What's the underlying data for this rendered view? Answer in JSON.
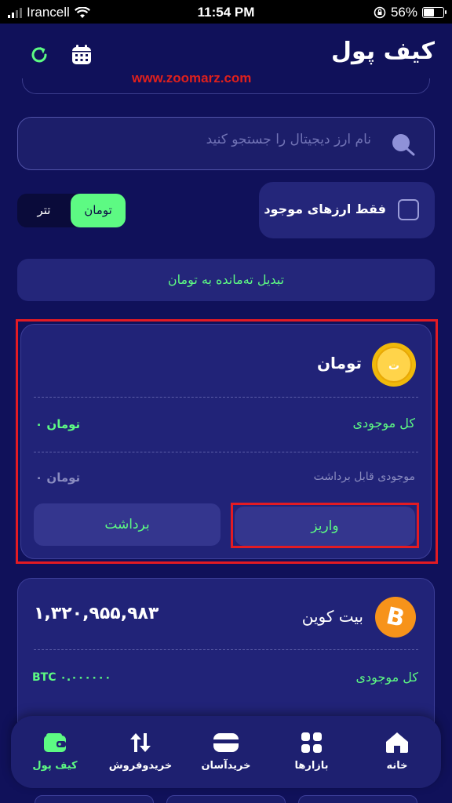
{
  "status_bar": {
    "carrier": "Irancell",
    "time": "11:54 PM",
    "battery": "56%",
    "battery_level": 0.56
  },
  "header": {
    "title": "کیف پول",
    "watermark": "www.zoomarz.com"
  },
  "search": {
    "placeholder": "نام ارز دیجیتال را جستجو کنید"
  },
  "filter": {
    "only_available_label": "فقط ارزهای موجود",
    "checked": false
  },
  "currency_toggle": {
    "toman": "تومان",
    "tether": "تتر",
    "selected": "toman"
  },
  "convert_button": "تبدیل ته‌مانده به تومان",
  "toman_card": {
    "name": "تومان",
    "total_label": "کل موجودی",
    "total_value": "۰ تومان",
    "withdrawable_label": "موجودی قابل برداشت",
    "withdrawable_value": "۰ تومان",
    "withdraw_button": "برداشت",
    "deposit_button": "واریز"
  },
  "btc_card": {
    "name": "بیت کوین",
    "value": "۱,۳۲۰,۹۵۵,۹۸۳",
    "total_label": "کل موجودی",
    "total_value": "BTC ۰.۰۰۰۰۰۰"
  },
  "bottom_nav": {
    "items": [
      {
        "label": "کیف پول",
        "icon": "wallet-icon",
        "active": true
      },
      {
        "label": "خریدوفروش",
        "icon": "trade-arrows-icon",
        "active": false
      },
      {
        "label": "خریدآسان",
        "icon": "card-icon",
        "active": false
      },
      {
        "label": "بازارها",
        "icon": "grid-icon",
        "active": false
      },
      {
        "label": "خانه",
        "icon": "home-icon",
        "active": false
      }
    ]
  },
  "colors": {
    "background": "#10115a",
    "accent_green": "#5dfa83",
    "highlight_red": "#e31b23"
  }
}
